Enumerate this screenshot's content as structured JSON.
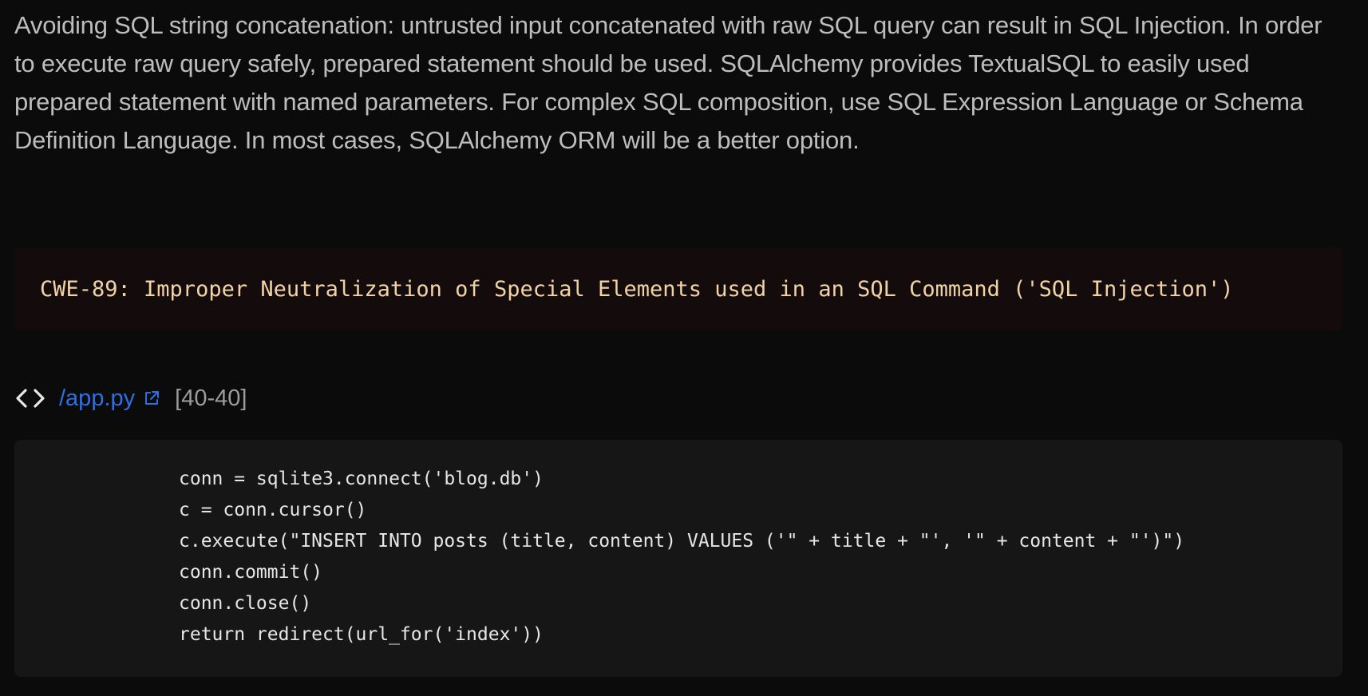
{
  "description": "Avoiding SQL string concatenation: untrusted input concatenated with raw SQL query can result in SQL Injection. In order to execute raw query safely, prepared statement should be used. SQLAlchemy provides TextualSQL to easily used prepared statement with named parameters. For complex SQL composition, use SQL Expression Language or Schema Definition Language. In most cases, SQLAlchemy ORM will be a better option.",
  "cwe": {
    "label": "CWE-89: Improper Neutralization of Special Elements used in an SQL Command ('SQL Injection')"
  },
  "file": {
    "icon": "code-brackets-icon",
    "path": "/app.py",
    "link_icon": "external-link-icon",
    "range": "[40-40]"
  },
  "code": {
    "lines": [
      "conn = sqlite3.connect('blog.db')",
      "c = conn.cursor()",
      "c.execute(\"INSERT INTO posts (title, content) VALUES ('\" + title + \"', '\" + content + \"')\")",
      "conn.commit()",
      "conn.close()",
      "return redirect(url_for('index'))"
    ]
  },
  "colors": {
    "background": "#0b0b0b",
    "cwe_background": "#140c0c",
    "cwe_text": "#f2d3a6",
    "link": "#2f6fe4",
    "code_background": "#161616"
  }
}
